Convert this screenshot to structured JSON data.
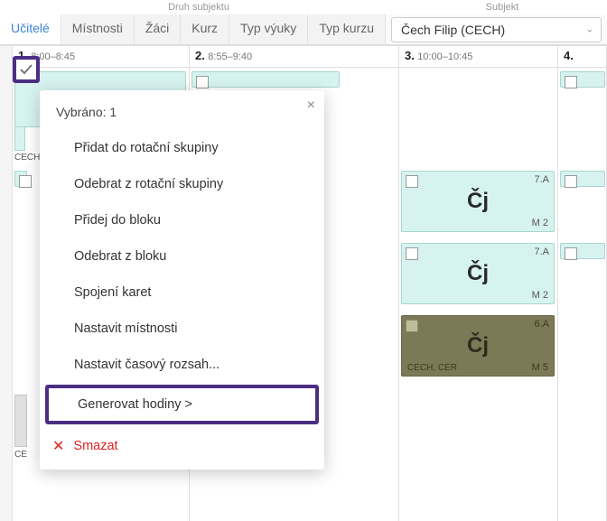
{
  "header_labels": {
    "left": "Druh subjektu",
    "right": "Subjekt"
  },
  "tabs": {
    "teachers": "Učitelé",
    "rooms": "Místnosti",
    "students": "Žáci",
    "course": "Kurz",
    "lesson_type": "Typ výuky",
    "course_type": "Typ kurzu"
  },
  "subject_select": {
    "value": "Čech Filip (CECH)"
  },
  "columns": {
    "c1": {
      "num": "1.",
      "time": "8:00–8:45"
    },
    "c2": {
      "num": "2.",
      "time": "8:55–9:40"
    },
    "c3": {
      "num": "3.",
      "time": "10:00–10:45"
    },
    "c4": {
      "num": "4.",
      "time": ""
    }
  },
  "card_fragment_teacher": "CECH",
  "cards": {
    "c3a": {
      "cls": "7.A",
      "subj": "Čj",
      "room": "M 2"
    },
    "c3b": {
      "cls": "7.A",
      "subj": "Čj",
      "room": "M 2"
    },
    "c3c": {
      "cls": "6.A",
      "subj": "Čj",
      "room": "M 5",
      "teacher": "CECH, CER"
    }
  },
  "context_menu": {
    "title": "Vybráno: 1",
    "items": {
      "add_rotation": "Přidat do rotační skupiny",
      "remove_rotation": "Odebrat z rotační skupiny",
      "add_block": "Přidej do bloku",
      "remove_block": "Odebrat z bloku",
      "merge_cards": "Spojení karet",
      "set_rooms": "Nastavit místnosti",
      "set_time_range": "Nastavit časový rozsah...",
      "generate_hours": "Generovat hodiny >"
    },
    "delete": "Smazat"
  }
}
